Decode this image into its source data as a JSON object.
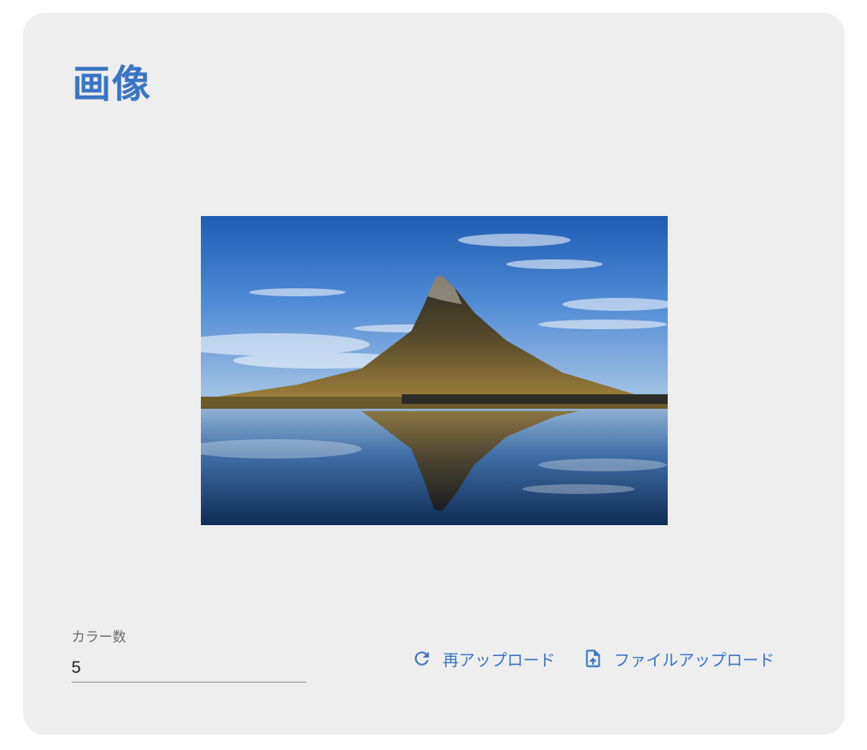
{
  "card": {
    "title": "画像"
  },
  "image": {
    "alt": "山の画像"
  },
  "color_count": {
    "label": "カラー数",
    "value": "5"
  },
  "actions": {
    "reupload_label": "再アップロード",
    "file_upload_label": "ファイルアップロード",
    "reupload_icon": "refresh-icon",
    "file_upload_icon": "file-upload-icon"
  },
  "colors": {
    "accent": "#3a75c4",
    "card_background": "#eeeeee"
  }
}
